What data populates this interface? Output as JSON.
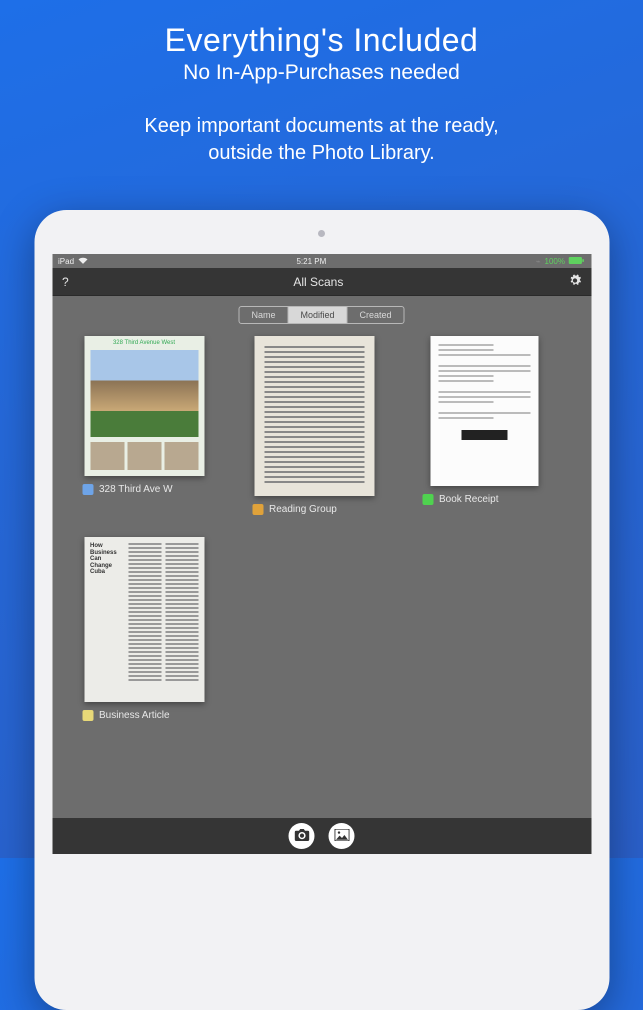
{
  "headline": {
    "title": "Everything's Included",
    "subtitle": "No In-App-Purchases needed"
  },
  "tagline_line1": "Keep important documents at the ready,",
  "tagline_line2": "outside the Photo Library.",
  "statusbar": {
    "device": "iPad",
    "time": "5:21 PM",
    "battery": "100%"
  },
  "navbar": {
    "help": "?",
    "title": "All Scans"
  },
  "segmented": {
    "opt0": "Name",
    "opt1": "Modified",
    "opt2": "Created"
  },
  "docs": [
    {
      "label": "328 Third Ave W",
      "color": "#6ea4e8",
      "thumb_title": "328 Third Avenue West"
    },
    {
      "label": "Reading Group",
      "color": "#e0a23a"
    },
    {
      "label": "Book Receipt",
      "color": "#4fd24f"
    },
    {
      "label": "Business Article",
      "color": "#e8d978",
      "thumb_heading": "How Business Can Change Cuba"
    }
  ]
}
